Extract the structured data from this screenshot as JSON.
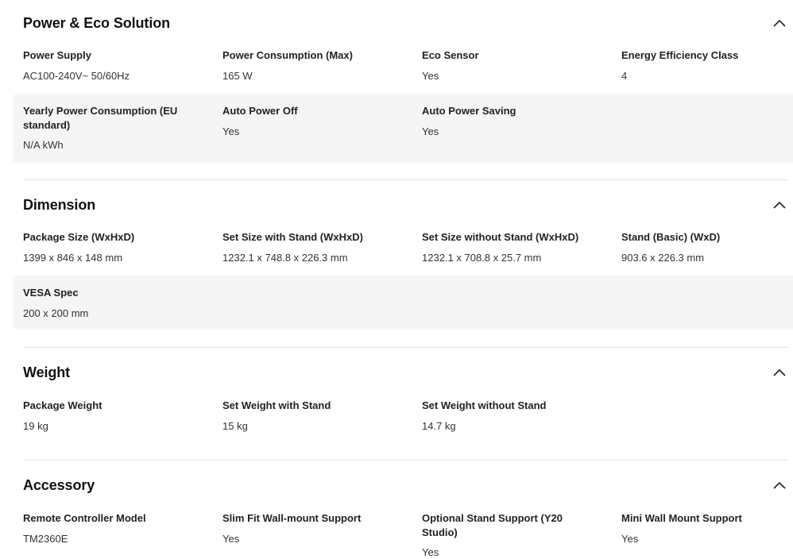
{
  "sections": [
    {
      "title": "Power & Eco Solution",
      "rows": [
        [
          {
            "label": "Power Supply",
            "value": "AC100-240V~ 50/60Hz"
          },
          {
            "label": "Power Consumption (Max)",
            "value": "165 W"
          },
          {
            "label": "Eco Sensor",
            "value": "Yes"
          },
          {
            "label": "Energy Efficiency Class",
            "value": "4"
          }
        ],
        [
          {
            "label": "Yearly Power Consumption (EU standard)",
            "value": "N/A kWh"
          },
          {
            "label": "Auto Power Off",
            "value": "Yes"
          },
          {
            "label": "Auto Power Saving",
            "value": "Yes"
          }
        ]
      ]
    },
    {
      "title": "Dimension",
      "rows": [
        [
          {
            "label": "Package Size (WxHxD)",
            "value": "1399 x 846 x 148 mm"
          },
          {
            "label": "Set Size with Stand (WxHxD)",
            "value": "1232.1 x 748.8 x 226.3 mm"
          },
          {
            "label": "Set Size without Stand (WxHxD)",
            "value": "1232.1 x 708.8 x 25.7 mm"
          },
          {
            "label": "Stand (Basic) (WxD)",
            "value": "903.6 x 226.3 mm"
          }
        ],
        [
          {
            "label": "VESA Spec",
            "value": "200 x 200 mm"
          }
        ]
      ]
    },
    {
      "title": "Weight",
      "rows": [
        [
          {
            "label": "Package Weight",
            "value": "19 kg"
          },
          {
            "label": "Set Weight with Stand",
            "value": "15 kg"
          },
          {
            "label": "Set Weight without Stand",
            "value": "14.7 kg"
          }
        ]
      ]
    },
    {
      "title": "Accessory",
      "rows": [
        [
          {
            "label": "Remote Controller Model",
            "value": "TM2360E"
          },
          {
            "label": "Slim Fit Wall-mount Support",
            "value": "Yes"
          },
          {
            "label": "Optional Stand Support (Y20 Studio)",
            "value": "Yes"
          },
          {
            "label": "Mini Wall Mount Support",
            "value": "Yes"
          }
        ]
      ]
    }
  ],
  "icons": {
    "collapse": "chevron-up-icon"
  },
  "colors": {
    "row_shade": "#f5f5f5",
    "divider": "#e3e3e3",
    "text": "#111111"
  }
}
